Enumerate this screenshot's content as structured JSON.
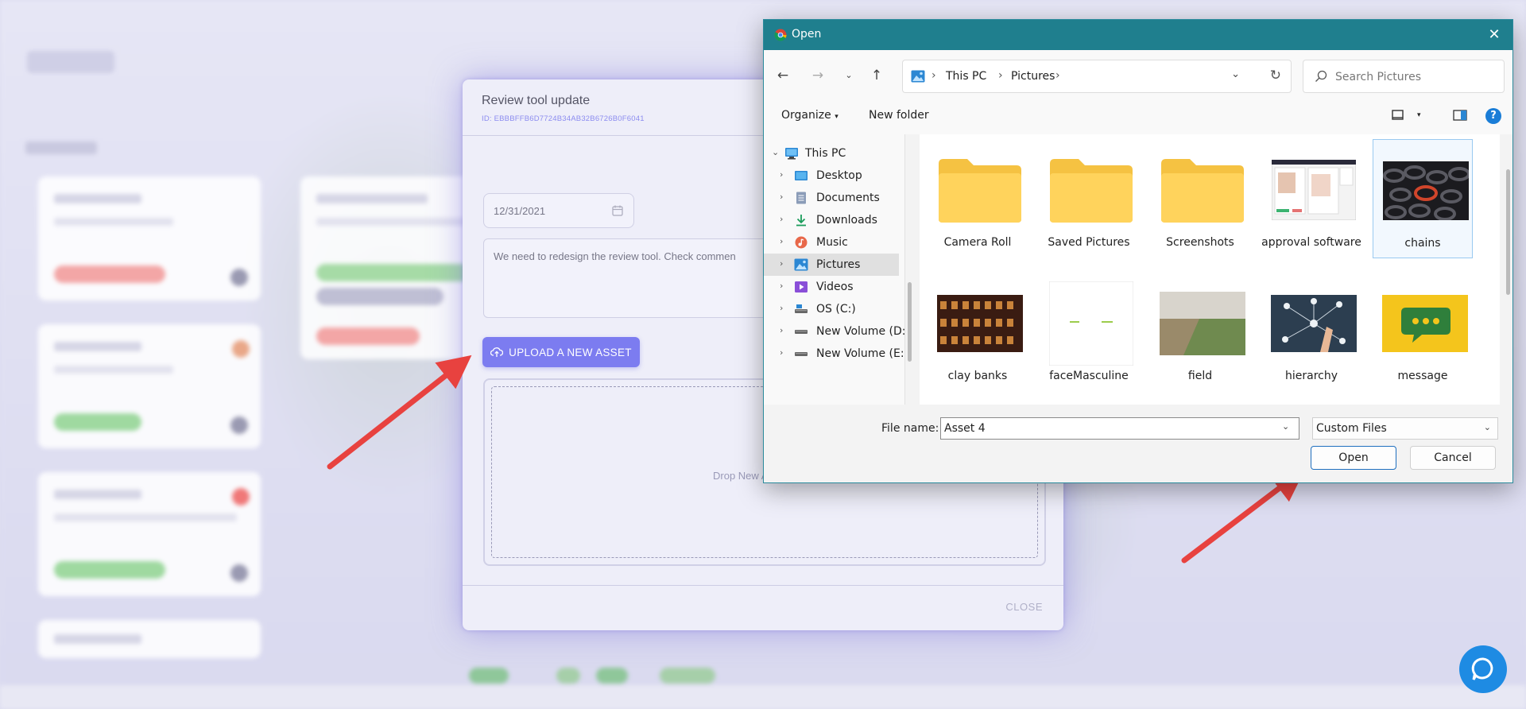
{
  "modal": {
    "title": "Review tool update",
    "id": "ID: EBBBFFB6D7724B34AB32B6726B0F6041",
    "date_value": "12/31/2021",
    "description": "We need to redesign the review tool. Check commen",
    "upload_button": "UPLOAD A NEW ASSET",
    "drop_text": "Drop New A",
    "close_button": "CLOSE"
  },
  "dialog": {
    "title": "Open",
    "breadcrumb": [
      "This PC",
      "Pictures"
    ],
    "search_placeholder": "Search Pictures",
    "commands": {
      "organize": "Organize",
      "new_folder": "New folder"
    },
    "tree": [
      {
        "label": "This PC",
        "icon": "this-pc-icon",
        "expanded": true
      },
      {
        "label": "Desktop",
        "icon": "desktop-icon"
      },
      {
        "label": "Documents",
        "icon": "documents-icon"
      },
      {
        "label": "Downloads",
        "icon": "downloads-icon"
      },
      {
        "label": "Music",
        "icon": "music-icon"
      },
      {
        "label": "Pictures",
        "icon": "pictures-icon",
        "selected": true
      },
      {
        "label": "Videos",
        "icon": "videos-icon"
      },
      {
        "label": "OS (C:)",
        "icon": "drive-icon"
      },
      {
        "label": "New Volume (D:",
        "icon": "drive-icon"
      },
      {
        "label": "New Volume (E:)",
        "icon": "drive-icon"
      }
    ],
    "files": [
      {
        "label": "Camera Roll",
        "kind": "folder"
      },
      {
        "label": "Saved Pictures",
        "kind": "folder"
      },
      {
        "label": "Screenshots",
        "kind": "folder"
      },
      {
        "label": "approval software",
        "kind": "image"
      },
      {
        "label": "chains",
        "kind": "image",
        "selected": true
      },
      {
        "label": "clay banks",
        "kind": "image"
      },
      {
        "label": "faceMasculine",
        "kind": "image"
      },
      {
        "label": "field",
        "kind": "image"
      },
      {
        "label": "hierarchy",
        "kind": "image"
      },
      {
        "label": "message",
        "kind": "image"
      }
    ],
    "file_name_label": "File name:",
    "file_name_value": "Asset 4",
    "file_type": "Custom Files",
    "open_button": "Open",
    "cancel_button": "Cancel"
  },
  "colors": {
    "accent": "#7c7cf0",
    "titlebar": "#1f7f8e",
    "arrow": "#e8423f",
    "chat": "#1e8be3"
  }
}
